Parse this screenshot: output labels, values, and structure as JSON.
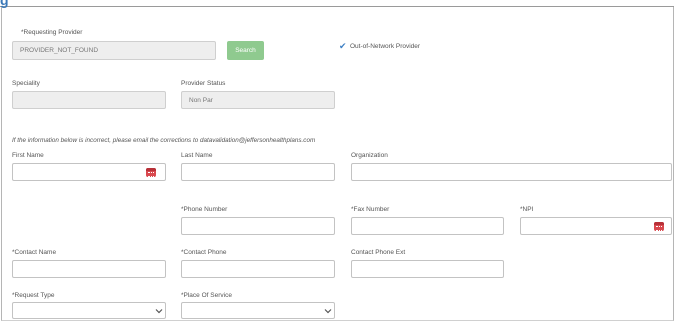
{
  "header": {
    "partial_glyph": "g"
  },
  "requesting_provider": {
    "label": "*Requesting Provider",
    "value": "PROVIDER_NOT_FOUND",
    "search_label": "Search"
  },
  "out_of_network": {
    "checked": true,
    "label": "Out-of-Network Provider"
  },
  "speciality": {
    "label": "Speciality",
    "value": ""
  },
  "provider_status": {
    "label": "Provider Status",
    "value": "Non Par"
  },
  "info_note": "If the information below is incorrect, please email the corrections to datavalidation@jeffersonhealthplans.com",
  "first_name": {
    "label": "First Name",
    "value": ""
  },
  "last_name": {
    "label": "Last Name",
    "value": ""
  },
  "organization": {
    "label": "Organization",
    "value": ""
  },
  "phone_number": {
    "label": "*Phone Number",
    "value": ""
  },
  "fax_number": {
    "label": "*Fax Number",
    "value": ""
  },
  "npi": {
    "label": "*NPI",
    "value": ""
  },
  "contact_name": {
    "label": "*Contact Name",
    "value": ""
  },
  "contact_phone": {
    "label": "*Contact Phone",
    "value": ""
  },
  "contact_phone_ext": {
    "label": "Contact Phone Ext",
    "value": ""
  },
  "request_type": {
    "label": "*Request Type",
    "selected": ""
  },
  "place_of_service": {
    "label": "*Place Of Service",
    "selected": ""
  },
  "colors": {
    "accent_green": "#8fca8f",
    "check_blue": "#3c7fc4",
    "picker_red": "#d9484e",
    "readonly_bg": "#eeeeee"
  }
}
